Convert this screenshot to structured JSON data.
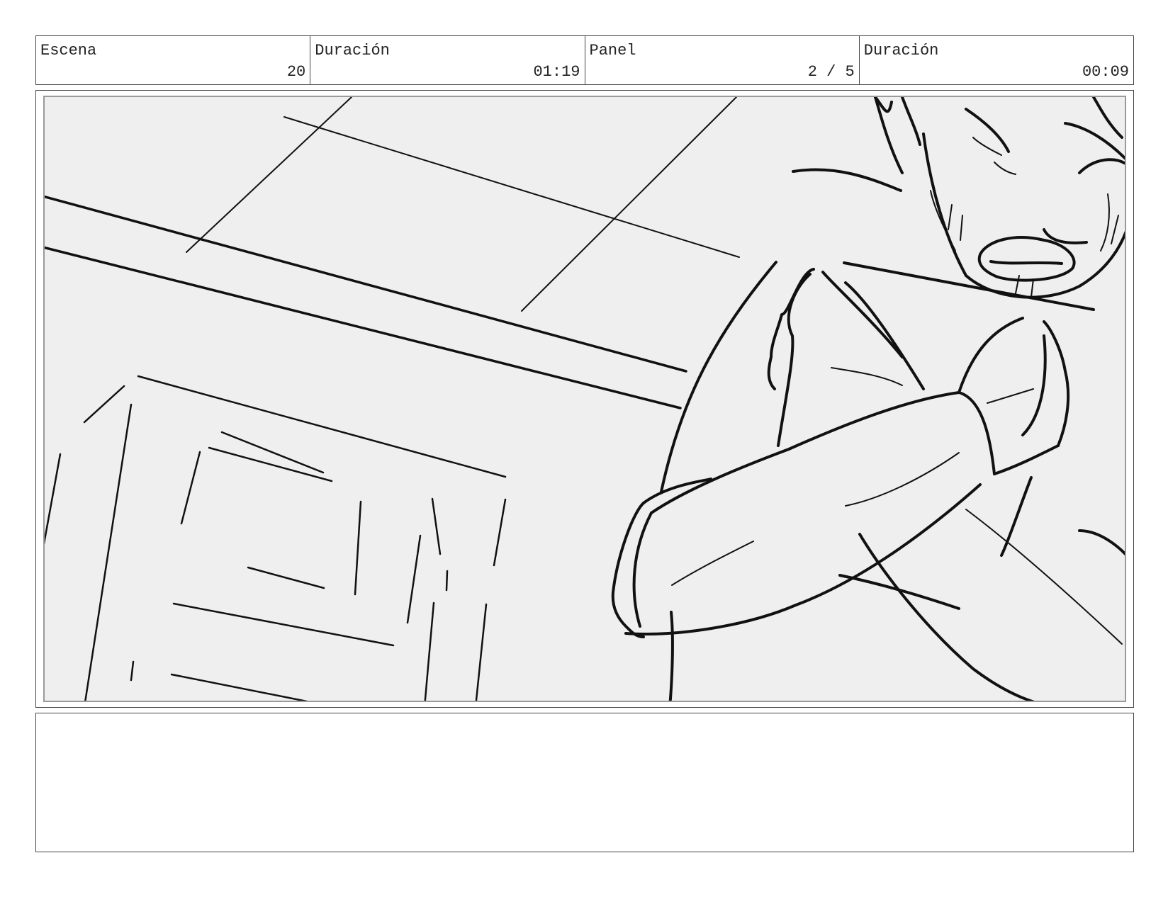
{
  "header": {
    "scene_label": "Escena",
    "scene_value": "20",
    "scene_duration_label": "Duración",
    "scene_duration_value": "01:19",
    "panel_label": "Panel",
    "panel_value": "2 / 5",
    "panel_duration_label": "Duración",
    "panel_duration_value": "00:09"
  },
  "notes": {
    "text": ""
  },
  "colors": {
    "panel_background": "#efefef",
    "ink": "#111111",
    "frame_border": "#9a9a9a"
  }
}
